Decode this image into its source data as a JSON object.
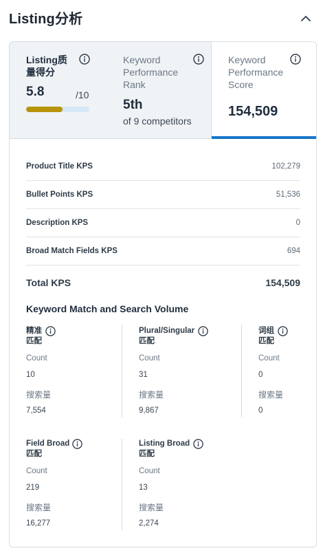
{
  "header": {
    "title": "Listing分析"
  },
  "metrics": {
    "quality": {
      "label": "Listing质量得分",
      "score": "5.8",
      "max": "/10",
      "progress": 0.58
    },
    "rank": {
      "label": "Keyword Performance Rank",
      "value": "5th",
      "sub": "of 9 competitors"
    },
    "kps": {
      "label": "Keyword Performance Score",
      "value": "154,509"
    }
  },
  "kps_rows": [
    {
      "label": "Product Title KPS",
      "value": "102,279"
    },
    {
      "label": "Bullet Points KPS",
      "value": "51,536"
    },
    {
      "label": "Description KPS",
      "value": "0"
    },
    {
      "label": "Broad Match Fields KPS",
      "value": "694"
    }
  ],
  "kps_total": {
    "label": "Total KPS",
    "value": "154,509"
  },
  "match": {
    "title": "Keyword Match and Search Volume",
    "count_label": "Count",
    "volume_label": "搜索量",
    "columns": [
      {
        "name_line1": "精准",
        "name_line2": "匹配",
        "count": "10",
        "volume": "7,554"
      },
      {
        "name_line1": "Plural/Singular",
        "name_line2": "匹配",
        "count": "31",
        "volume": "9,867"
      },
      {
        "name_line1": "词组",
        "name_line2": "匹配",
        "count": "0",
        "volume": "0"
      },
      {
        "name_line1": "Field Broad",
        "name_line2": "匹配",
        "count": "219",
        "volume": "16,277"
      },
      {
        "name_line1": "Listing Broad",
        "name_line2": "匹配",
        "count": "13",
        "volume": "2,274"
      }
    ]
  },
  "colors": {
    "accent": "#1575c9",
    "score_bar": "#b8930c",
    "score_track": "#d5e8f7"
  },
  "icons": {
    "info": "info-icon",
    "collapse": "chevron-up-icon"
  }
}
